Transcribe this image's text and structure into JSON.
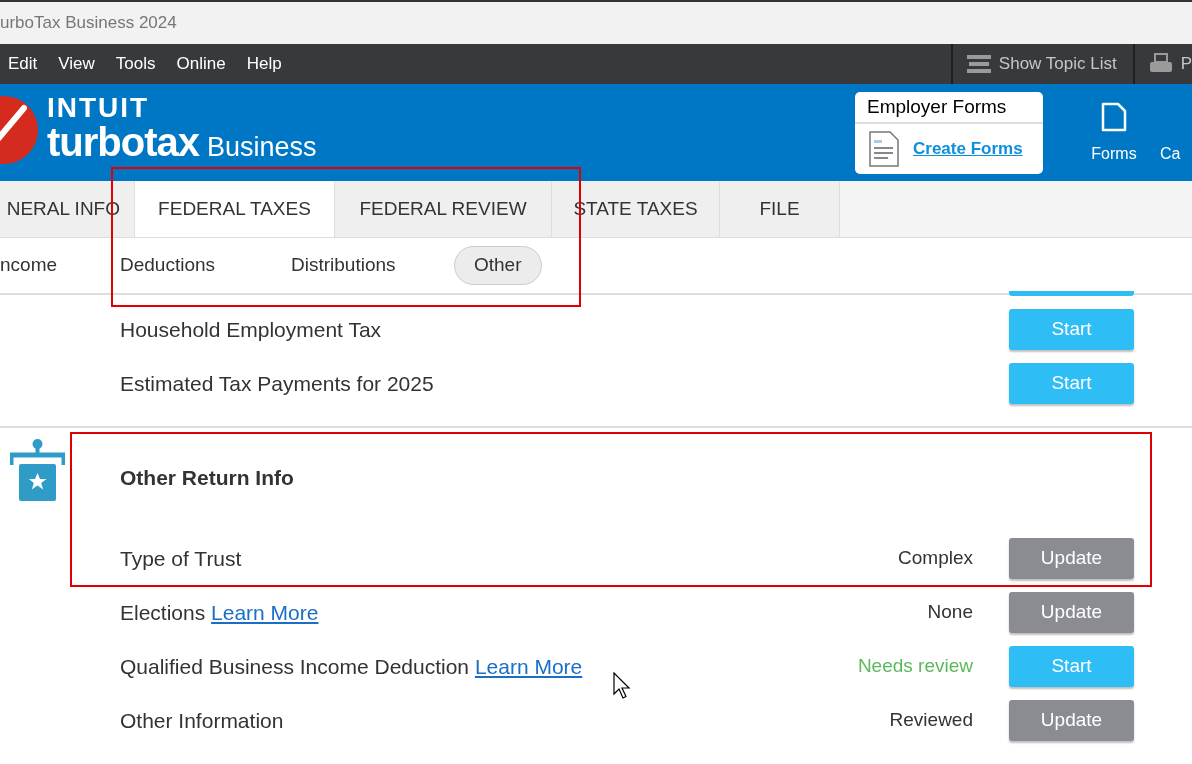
{
  "window": {
    "title": "urboTax Business 2024"
  },
  "menu": [
    "Edit",
    "View",
    "Tools",
    "Online",
    "Help"
  ],
  "toolbar": [
    {
      "kind": "topics",
      "label": "Show Topic List"
    },
    {
      "kind": "print",
      "label": "P"
    }
  ],
  "brand": {
    "company": "INTUIT",
    "product": "turbotax",
    "edition": "Business"
  },
  "employer_forms": {
    "title": "Employer Forms",
    "link": "Create Forms"
  },
  "header_buttons": [
    {
      "kind": "forms",
      "label": "Forms"
    },
    {
      "kind": "other",
      "label": "Ca"
    }
  ],
  "tabs_highlighted": true,
  "tabs": [
    {
      "label": "NERAL INFO",
      "selected": false
    },
    {
      "label": "FEDERAL TAXES",
      "selected": true
    },
    {
      "label": "FEDERAL REVIEW",
      "selected": false
    },
    {
      "label": "STATE TAXES",
      "selected": false
    },
    {
      "label": "FILE",
      "selected": false
    }
  ],
  "subtabs": [
    {
      "label": "ncome",
      "selected": false
    },
    {
      "label": "Deductions",
      "selected": false
    },
    {
      "label": "Distributions",
      "selected": false
    },
    {
      "label": "Other",
      "selected": true
    }
  ],
  "top_rows": [
    {
      "label": "Household Employment Tax",
      "button": {
        "kind": "start",
        "label": "Start"
      }
    },
    {
      "label": "Estimated Tax Payments for 2025",
      "button": {
        "kind": "start",
        "label": "Start"
      }
    }
  ],
  "section": {
    "title": "Other Return Info",
    "highlighted": true,
    "rows": [
      {
        "label": "Type of Trust",
        "status": {
          "text": "Complex",
          "color": "#333333"
        },
        "button": {
          "kind": "update",
          "label": "Update"
        }
      },
      {
        "label": "Elections",
        "link": "Learn More",
        "status": {
          "text": "None",
          "color": "#333333"
        },
        "button": {
          "kind": "update",
          "label": "Update"
        }
      },
      {
        "label": "Qualified Business Income Deduction",
        "link": "Learn More",
        "status": {
          "text": "Needs review",
          "color": "#5cb85c"
        },
        "button": {
          "kind": "start",
          "label": "Start"
        }
      },
      {
        "label": "Other Information",
        "status": {
          "text": "Reviewed",
          "color": "#333333"
        },
        "button": {
          "kind": "update",
          "label": "Update"
        }
      }
    ]
  }
}
